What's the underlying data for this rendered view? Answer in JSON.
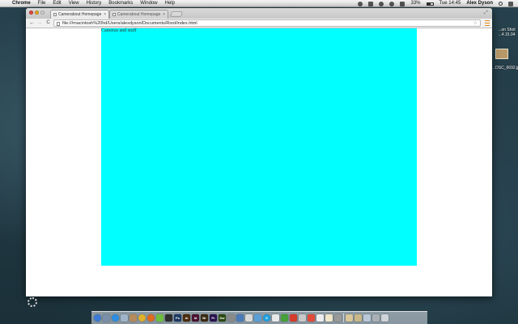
{
  "menubar": {
    "apple": "",
    "app_name": "Chrome",
    "menus": [
      "File",
      "Edit",
      "View",
      "History",
      "Bookmarks",
      "Window",
      "Help"
    ],
    "battery_percent": "33%",
    "clock": "Tue 14:45",
    "user": "Alex Dyson"
  },
  "desktop_items": [
    {
      "label": "...on Shot",
      "label2": "...4.15.04"
    },
    {
      "label": "...DSC_6692.jpg"
    }
  ],
  "chrome": {
    "tabs": [
      {
        "title": "Camerabout Homepage",
        "active": true,
        "close": "×"
      },
      {
        "title": "Camerabout Homepage",
        "active": false,
        "close": "×"
      }
    ],
    "nav": {
      "back": "←",
      "forward": "→",
      "reload": "C"
    },
    "url": "file:///macintosh%20hd/Users/alexdyson/Documents/Root/index.html",
    "star": "☆",
    "resize": "⤢"
  },
  "page": {
    "text": "Cameras and stuff",
    "box_color": "#00ffff"
  },
  "dock": {
    "icons": [
      {
        "name": "finder-icon",
        "color": "#3b7bd6",
        "text": ""
      },
      {
        "name": "launchpad-icon",
        "color": "#7a8fa8",
        "text": ""
      },
      {
        "name": "safari-icon",
        "color": "#2d8ee0",
        "text": ""
      },
      {
        "name": "mail-icon",
        "color": "#9fb4c9",
        "text": ""
      },
      {
        "name": "contacts-icon",
        "color": "#b58a5c",
        "text": ""
      },
      {
        "name": "chrome-icon",
        "color": "#e0b12a",
        "text": ""
      },
      {
        "name": "firefox-icon",
        "color": "#e06a1d",
        "text": ""
      },
      {
        "name": "itunes-icon",
        "color": "#6fbf3f",
        "text": ""
      },
      {
        "name": "app-icon",
        "color": "#2d2d2d",
        "text": ""
      },
      {
        "name": "photoshop-icon",
        "color": "#1c3b63",
        "text": "Ps"
      },
      {
        "name": "illustrator-icon",
        "color": "#4a2a0c",
        "text": "Ai"
      },
      {
        "name": "indesign-icon",
        "color": "#4a1230",
        "text": "Id"
      },
      {
        "name": "bridge-icon",
        "color": "#3b2a12",
        "text": "Br"
      },
      {
        "name": "premiere-icon",
        "color": "#2a1450",
        "text": "Pr"
      },
      {
        "name": "dreamweaver-icon",
        "color": "#2c4a12",
        "text": "Dw"
      },
      {
        "name": "app-icon",
        "color": "#8a8a8a",
        "text": ""
      },
      {
        "name": "app-icon",
        "color": "#4a7ab8",
        "text": ""
      },
      {
        "name": "app-icon",
        "color": "#d9d9d9",
        "text": ""
      },
      {
        "name": "app-icon",
        "color": "#5aa0d8",
        "text": ""
      },
      {
        "name": "skype-icon",
        "color": "#1ea1e0",
        "text": "S"
      },
      {
        "name": "app-icon",
        "color": "#e8e8e8",
        "text": ""
      },
      {
        "name": "app-icon",
        "color": "#46a03c",
        "text": ""
      },
      {
        "name": "app-icon",
        "color": "#d43c2c",
        "text": ""
      },
      {
        "name": "app-icon",
        "color": "#c8c8c8",
        "text": ""
      },
      {
        "name": "app-icon",
        "color": "#e04a3a",
        "text": ""
      },
      {
        "name": "app-icon",
        "color": "#ededed",
        "text": ""
      },
      {
        "name": "app-icon",
        "color": "#f0e6c8",
        "text": ""
      },
      {
        "name": "app-icon",
        "color": "#9a9a9a",
        "text": ""
      },
      {
        "name": "folder-icon",
        "color": "#d8c89a",
        "text": ""
      },
      {
        "name": "folder-icon",
        "color": "#c8b888",
        "text": ""
      },
      {
        "name": "folder-icon",
        "color": "#b8c8d8",
        "text": ""
      },
      {
        "name": "app-icon",
        "color": "#aab0b6",
        "text": ""
      },
      {
        "name": "trash-icon",
        "color": "#cfd4d8",
        "text": ""
      }
    ]
  }
}
